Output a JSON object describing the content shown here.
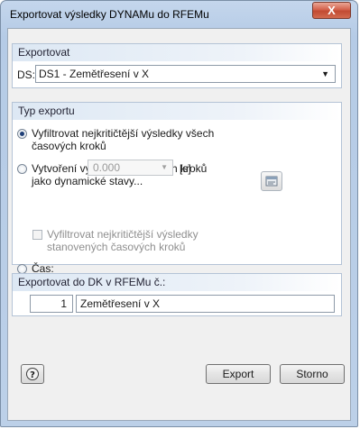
{
  "window": {
    "title": "Exportovat výsledky DYNAMu do RFEMu",
    "close_label": "X"
  },
  "export_group": {
    "header": "Exportovat",
    "ds_label": "DS:",
    "ds_value": "DS1 - Zemětřesení v X"
  },
  "type_group": {
    "header": "Typ exportu",
    "option1": "Vyfiltrovat nejkritičtější výsledky všech\nčasových kroků",
    "option2": "Vytvoření vybraných časových kroků\njako dynamické stavy...",
    "sub_option": "Vyfiltrovat nejkritičtější výsledky\nstanovených časových kroků",
    "option3": "Čas:",
    "time_value": "0.000",
    "time_unit": "[s]",
    "selected": "option1"
  },
  "dk_group": {
    "header": "Exportovat do DK v RFEMu č.:",
    "number": "1",
    "name": "Zemětřesení v X"
  },
  "buttons": {
    "export": "Export",
    "storno": "Storno"
  },
  "icons": {
    "help": "help-icon",
    "pick": "select-time-steps-icon"
  },
  "colors": {
    "title_gradient": "#b5cbe6",
    "close_button": "#c24a32",
    "radio_dot": "#1f3f77"
  }
}
